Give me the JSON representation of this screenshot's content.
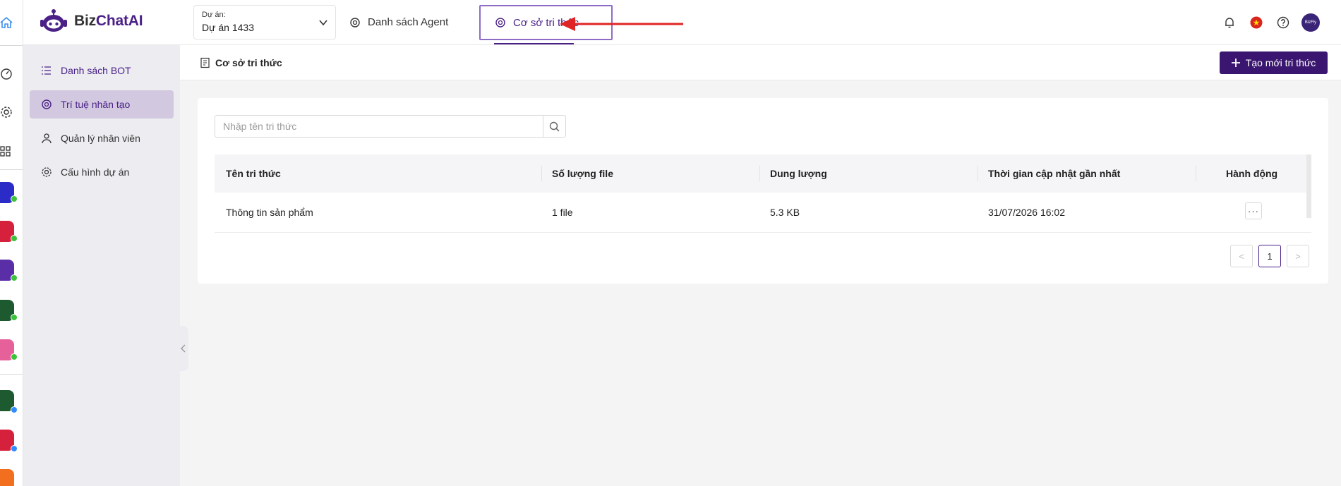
{
  "brand": {
    "name_part1": "Biz",
    "name_part2": "ChatAI",
    "accent": "#4b2187"
  },
  "project": {
    "label": "Dự án:",
    "value": "Dự án 1433"
  },
  "top_tabs": {
    "agents": "Danh sách Agent",
    "knowledge": "Cơ sở tri thức"
  },
  "header_icons": [
    "bell-icon",
    "vietnam-flag-icon",
    "help-icon",
    "avatar"
  ],
  "avatar_text": "BizFly",
  "sidebar": {
    "items": [
      {
        "label": "Danh sách BOT",
        "icon": "list-icon"
      },
      {
        "label": "Trí tuệ nhân tạo",
        "icon": "ai-icon",
        "active": true
      },
      {
        "label": "Quản lý nhân viên",
        "icon": "user-icon"
      },
      {
        "label": "Cấu hình dự án",
        "icon": "gear-icon"
      }
    ]
  },
  "page": {
    "title": "Cơ sở tri thức",
    "create_button": "Tạo mới tri thức"
  },
  "search": {
    "placeholder": "Nhập tên tri thức",
    "value": ""
  },
  "table": {
    "headers": [
      "Tên tri thức",
      "Số lượng file",
      "Dung lượng",
      "Thời gian cập nhật gần nhất",
      "Hành động"
    ],
    "rows": [
      {
        "name": "Thông tin sản phẩm",
        "files": "1 file",
        "size": "5.3 KB",
        "updated": "31/07/2026 16:02",
        "action": "···"
      }
    ]
  },
  "pagination": {
    "prev": "<",
    "current": "1",
    "next": ">"
  }
}
